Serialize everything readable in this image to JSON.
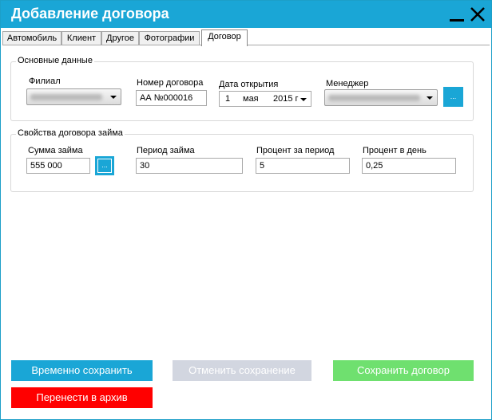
{
  "window": {
    "title": "Добавление договора",
    "accent_color": "#1aa6d6"
  },
  "tabs": [
    {
      "label": "Автомобиль",
      "active": false
    },
    {
      "label": "Клиент",
      "active": false
    },
    {
      "label": "Другое",
      "active": false
    },
    {
      "label": "Фотографии",
      "active": false
    },
    {
      "label": "Договор",
      "active": true
    }
  ],
  "basic": {
    "group_title": "Основные данные",
    "branch_label": "Филиал",
    "branch_value_blurred": true,
    "contract_number_label": "Номер договора",
    "contract_number_value": "АА №000016",
    "open_date_label": "Дата открытия",
    "open_date": {
      "day": "1",
      "month": "мая",
      "year": "2015 г"
    },
    "manager_label": "Менеджер",
    "manager_value_blurred": true,
    "manager_button": "..."
  },
  "loan": {
    "group_title": "Свойства договора займа",
    "amount_label": "Сумма займа",
    "amount_value": "555 000",
    "amount_button": "...",
    "period_label": "Период займа",
    "period_value": "30",
    "rate_period_label": "Процент за период",
    "rate_period_value": "5",
    "rate_day_label": "Процент в день",
    "rate_day_value": "0,25"
  },
  "actions": {
    "temp_save": {
      "label": "Временно сохранить",
      "color": "#1aa6d6"
    },
    "cancel_save": {
      "label": "Отменить сохранение",
      "color": "#d2d6e0"
    },
    "save_contract": {
      "label": "Сохранить договор",
      "color": "#6fe06f"
    },
    "archive": {
      "label": "Перенести в архив",
      "color": "#ff0000"
    }
  }
}
